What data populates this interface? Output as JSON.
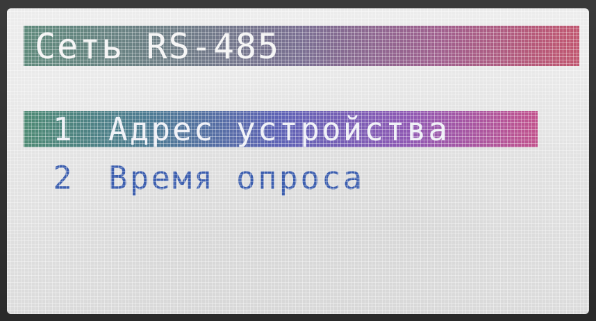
{
  "screen": {
    "title": "Сеть RS-485",
    "menu": [
      {
        "number": "1",
        "label": "Адрес устройства",
        "selected": true
      },
      {
        "number": "2",
        "label": "Время опроса",
        "selected": false
      }
    ]
  },
  "colors": {
    "title_gradient": [
      "#5f8a7c",
      "#7a6f92",
      "#c0566f"
    ],
    "selected_gradient": [
      "#4e8a74",
      "#5e62b5",
      "#c1538d"
    ],
    "normal_text": "#3c5eae",
    "screen_background": "#e9e9e9"
  }
}
